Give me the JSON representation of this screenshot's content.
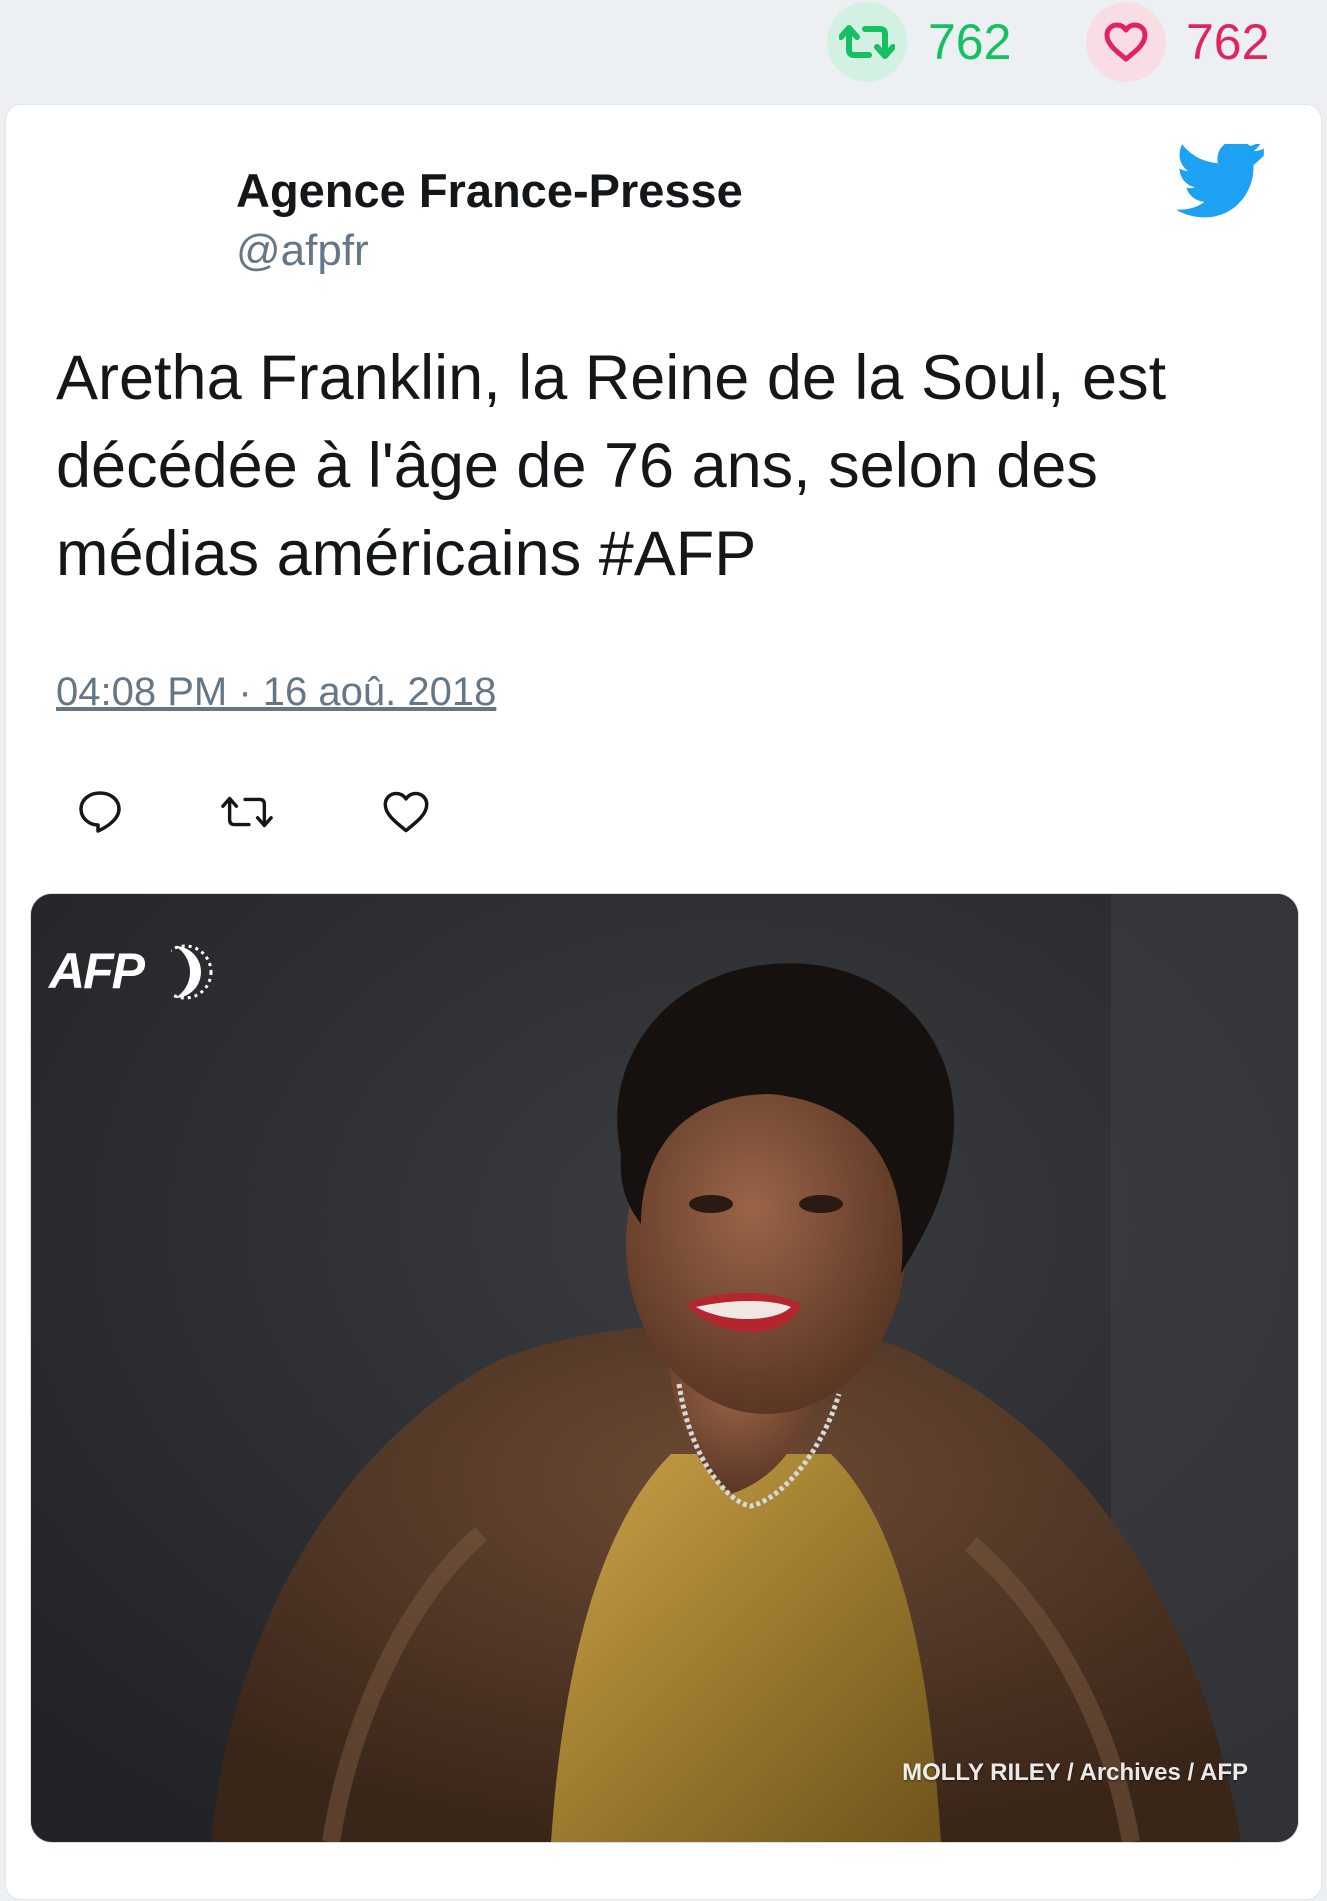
{
  "stats": {
    "retweet_count": "762",
    "like_count": "762",
    "retweet_icon": "retweet-icon",
    "like_icon": "heart-icon",
    "retweet_color": "#17bf63",
    "like_color": "#e0245e"
  },
  "tweet": {
    "author_name": "Agence France-Presse",
    "author_handle": "@afpfr",
    "text": "Aretha Franklin, la Reine de la Soul, est décédée à l'âge de 76 ans, selon des médias américains #AFP",
    "timestamp": "04:08 PM · 16 aoû. 2018",
    "brand_icon": "twitter-bird-icon",
    "brand_color": "#1da1f2"
  },
  "actions": {
    "reply_icon": "reply-icon",
    "retweet_icon": "retweet-icon",
    "like_icon": "heart-icon"
  },
  "media": {
    "logo_text": "AFP",
    "credit": "MOLLY RILEY / Archives / AFP"
  }
}
